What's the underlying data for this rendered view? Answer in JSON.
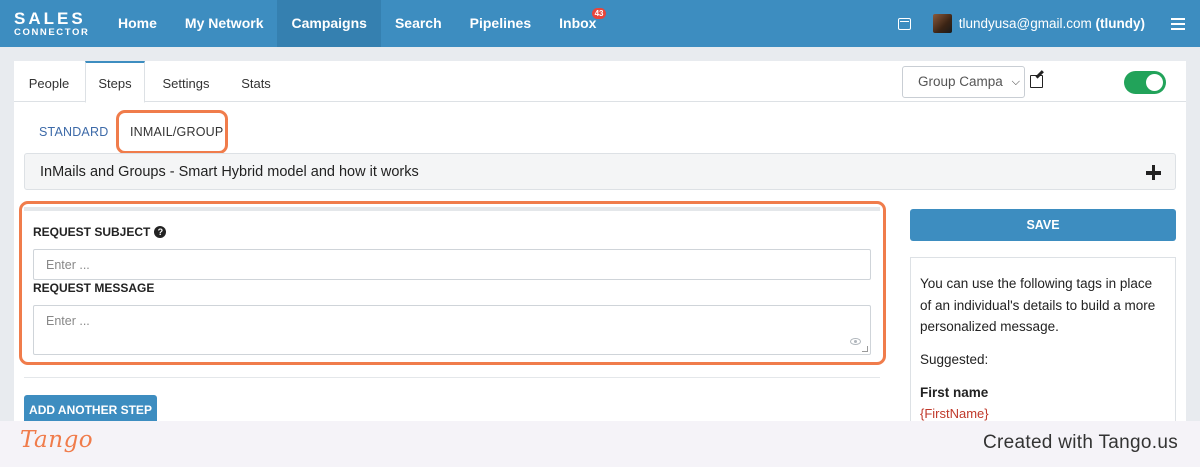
{
  "app": {
    "logo_line1": "SALES",
    "logo_line2": "CONNECTOR"
  },
  "nav": {
    "items": [
      {
        "label": "Home"
      },
      {
        "label": "My Network"
      },
      {
        "label": "Campaigns",
        "active": true
      },
      {
        "label": "Search"
      },
      {
        "label": "Pipelines"
      },
      {
        "label": "Inbox",
        "badge": "43"
      }
    ],
    "user_email": "tlundyusa@gmail.com",
    "user_handle": "(tlundy)"
  },
  "tabs": [
    "People",
    "Steps",
    "Settings",
    "Stats"
  ],
  "campaign_select": {
    "value": "Group Campa"
  },
  "toggle": {
    "on": true
  },
  "subtabs": {
    "standard": "STANDARD",
    "inmail": "INMAIL/GROUP"
  },
  "accordion": {
    "title": "InMails and Groups - Smart Hybrid model and how it works"
  },
  "form": {
    "subject_label": "REQUEST SUBJECT",
    "subject_placeholder": "Enter ...",
    "message_label": "REQUEST MESSAGE",
    "message_placeholder": "Enter ..."
  },
  "add_step_label": "ADD ANOTHER STEP",
  "save_label": "SAVE",
  "tags_panel": {
    "intro": "You can use the following tags in place of an individual's details to build a more personalized message.",
    "suggested": "Suggested:",
    "first_name_label": "First name",
    "first_name_tag": "{FirstName}"
  },
  "footer": {
    "logo": "Tango",
    "created": "Created with Tango.us"
  },
  "colors": {
    "primary": "#3d8dc0",
    "highlight": "#f07c4b",
    "toggle_on": "#22a35a",
    "badge": "#e8453c"
  }
}
